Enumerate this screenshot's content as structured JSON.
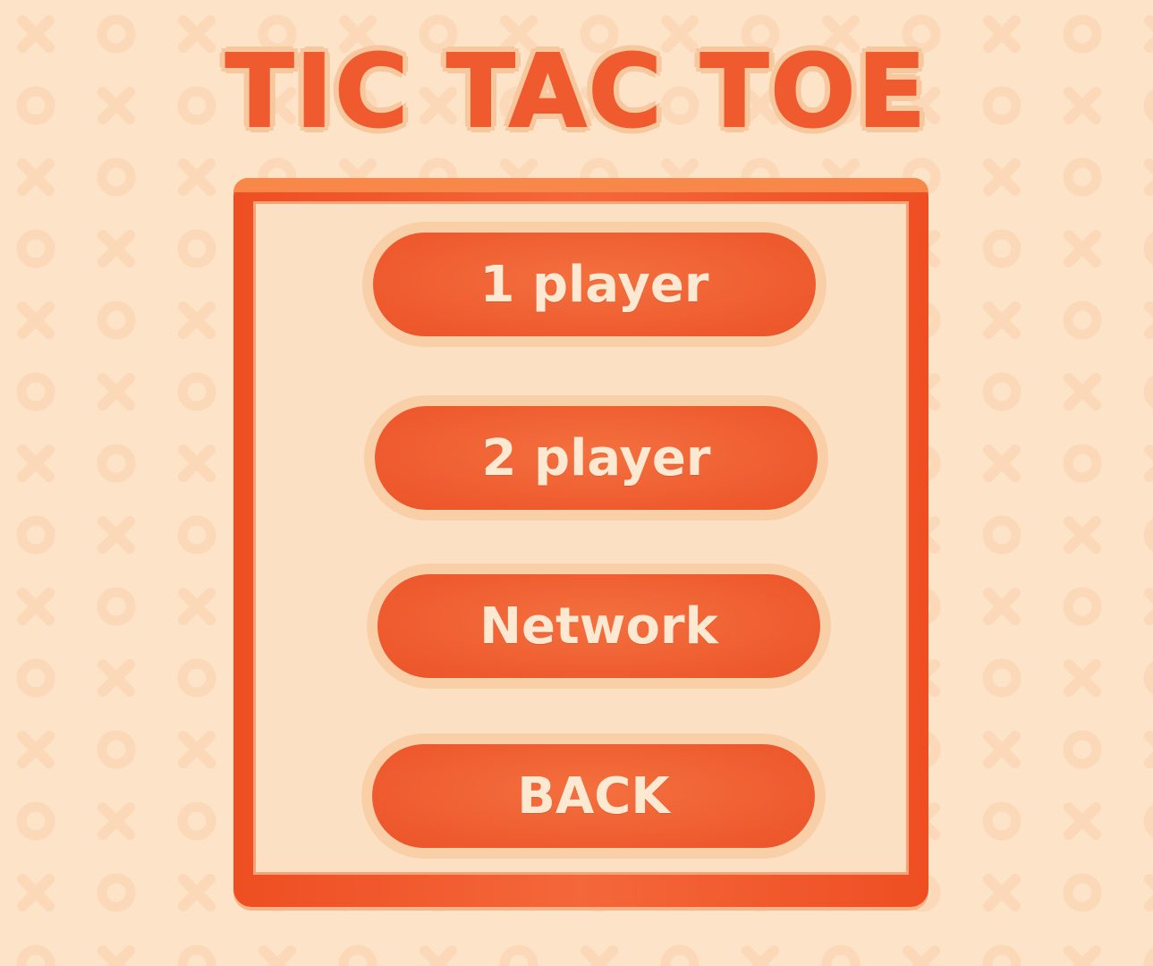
{
  "title": "TIC TAC TOE",
  "menu": {
    "one_player": "1 player",
    "two_player": "2 player",
    "network": "Network",
    "back": "BACK"
  },
  "background": {
    "pattern_icons": [
      "x-icon",
      "o-icon"
    ]
  },
  "colors": {
    "background": "#fde3c7",
    "pattern": "#fbd8b8",
    "accent": "#ef5a2e",
    "button_text": "#fde8d2",
    "panel_inner": "#fce0c4"
  }
}
